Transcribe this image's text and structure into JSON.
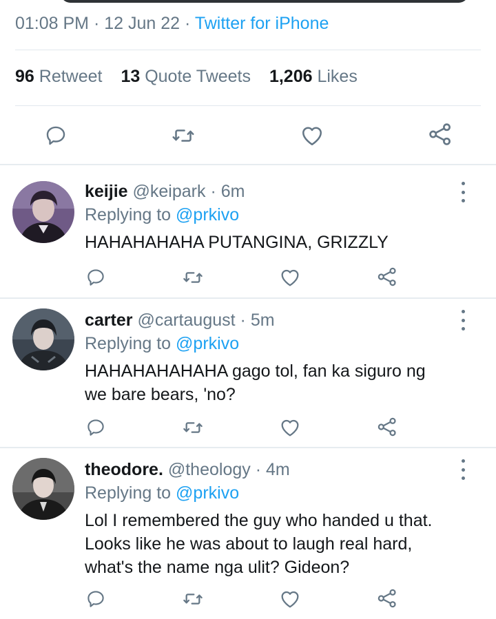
{
  "tweet": {
    "time": "01:08 PM",
    "date": "12 Jun 22",
    "source": "Twitter for iPhone",
    "stats": {
      "retweets_count": "96",
      "retweets_label": "Retweet",
      "quotes_count": "13",
      "quotes_label": "Quote Tweets",
      "likes_count": "1,206",
      "likes_label": "Likes"
    }
  },
  "replies": [
    {
      "name": "keijie",
      "handle": "@keipark",
      "time": "6m",
      "replying_prefix": "Replying to",
      "mention": "@prkivo",
      "lines": [
        "HAHAHAHAHA PUTANGINA, GRIZZLY"
      ]
    },
    {
      "name": "carter",
      "handle": "@cartaugust",
      "time": "5m",
      "replying_prefix": "Replying to",
      "mention": "@prkivo",
      "lines": [
        "HAHAHAHAHAHA gago tol, fan ka siguro ng",
        "we bare bears, 'no?"
      ]
    },
    {
      "name": "theodore.",
      "handle": "@theology",
      "time": "4m",
      "replying_prefix": "Replying to",
      "mention": "@prkivo",
      "lines": [
        "Lol I remembered the guy who handed u that.",
        "Looks like he was about to laugh real hard,",
        "what's the name nga ulit? Gideon?"
      ]
    }
  ],
  "icons": {
    "reply": "reply-icon",
    "retweet": "retweet-icon",
    "like": "heart-icon",
    "share": "share-icon",
    "more": "more-icon"
  },
  "colors": {
    "accent": "#1da1f2",
    "secondary_text": "#657786",
    "primary_text": "#14171a",
    "divider": "#e1e8ed"
  }
}
